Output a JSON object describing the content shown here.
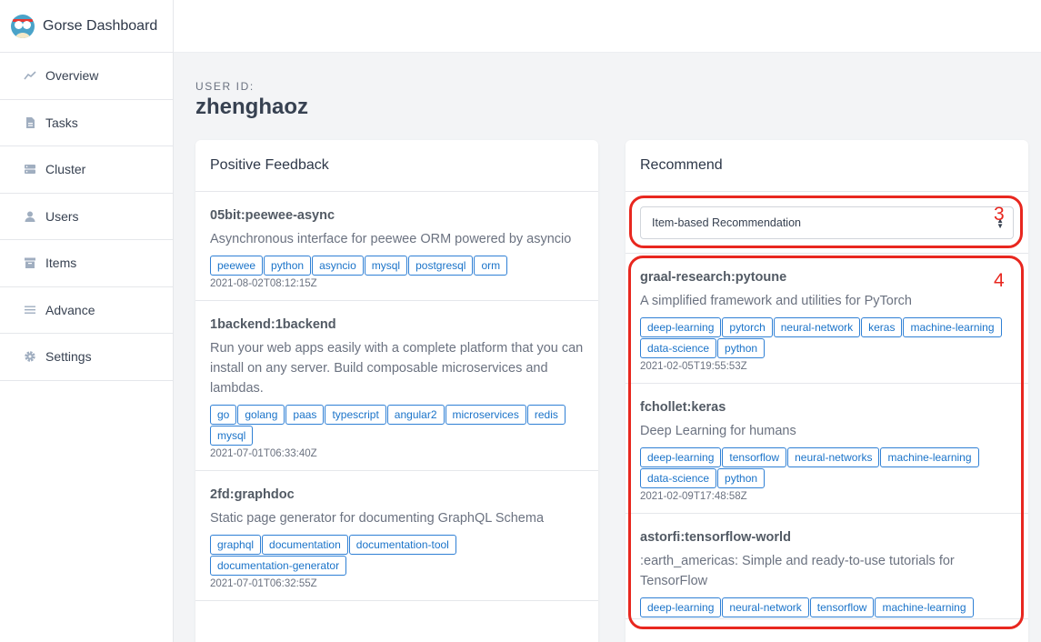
{
  "app": {
    "title": "Gorse Dashboard"
  },
  "sidebar": {
    "items": [
      {
        "label": "Overview",
        "icon": "chart-line-icon"
      },
      {
        "label": "Tasks",
        "icon": "document-icon"
      },
      {
        "label": "Cluster",
        "icon": "server-icon"
      },
      {
        "label": "Users",
        "icon": "user-icon"
      },
      {
        "label": "Items",
        "icon": "archive-icon"
      },
      {
        "label": "Advance",
        "icon": "list-icon"
      },
      {
        "label": "Settings",
        "icon": "gear-icon"
      }
    ]
  },
  "user": {
    "id_label": "USER ID:",
    "id": "zhenghaoz"
  },
  "feedback": {
    "title": "Positive Feedback",
    "items": [
      {
        "title": "05bit:peewee-async",
        "desc": "Asynchronous interface for peewee ORM powered by asyncio",
        "tags": [
          "peewee",
          "python",
          "asyncio",
          "mysql",
          "postgresql",
          "orm"
        ],
        "time": "2021-08-02T08:12:15Z"
      },
      {
        "title": "1backend:1backend",
        "desc": "Run your web apps easily with a complete platform that you can install on any server. Build composable microservices and lambdas.",
        "tags": [
          "go",
          "golang",
          "paas",
          "typescript",
          "angular2",
          "microservices",
          "redis",
          "mysql"
        ],
        "time": "2021-07-01T06:33:40Z"
      },
      {
        "title": "2fd:graphdoc",
        "desc": "Static page generator for documenting GraphQL Schema",
        "tags": [
          "graphql",
          "documentation",
          "documentation-tool",
          "documentation-generator"
        ],
        "time": "2021-07-01T06:32:55Z"
      }
    ]
  },
  "recommend": {
    "title": "Recommend",
    "select_value": "Item-based Recommendation",
    "items": [
      {
        "title": "graal-research:pytoune",
        "desc": "A simplified framework and utilities for PyTorch",
        "tags": [
          "deep-learning",
          "pytorch",
          "neural-network",
          "keras",
          "machine-learning",
          "data-science",
          "python"
        ],
        "time": "2021-02-05T19:55:53Z"
      },
      {
        "title": "fchollet:keras",
        "desc": "Deep Learning for humans",
        "tags": [
          "deep-learning",
          "tensorflow",
          "neural-networks",
          "machine-learning",
          "data-science",
          "python"
        ],
        "time": "2021-02-09T17:48:58Z"
      },
      {
        "title": "astorfi:tensorflow-world",
        "desc": ":earth_americas: Simple and ready-to-use tutorials for TensorFlow",
        "tags": [
          "deep-learning",
          "neural-network",
          "tensorflow",
          "machine-learning"
        ],
        "time": ""
      }
    ]
  },
  "annotations": [
    {
      "label": "3",
      "color": "#e8271f"
    },
    {
      "label": "4",
      "color": "#e8271f"
    }
  ]
}
